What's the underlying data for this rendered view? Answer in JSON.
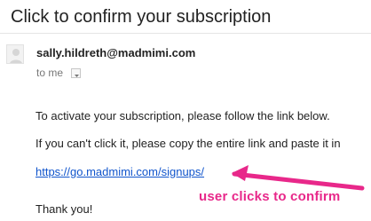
{
  "email": {
    "subject": "Click to confirm your subscription",
    "sender": "sally.hildreth@madmimi.com",
    "recipient_label": "to me",
    "body": {
      "line1": "To activate your subscription, please follow the link below.",
      "line2": "If you can't click it, please copy the entire link and paste it in",
      "link": "https://go.madmimi.com/signups/",
      "closing": "Thank you!"
    }
  },
  "annotation": {
    "text": "user clicks to confirm",
    "color": "#e8288a"
  },
  "icons": {
    "avatar": "avatar-icon",
    "dropdown": "chevron-down-icon"
  },
  "colors": {
    "link": "#1155cc",
    "annotation": "#e8288a"
  }
}
